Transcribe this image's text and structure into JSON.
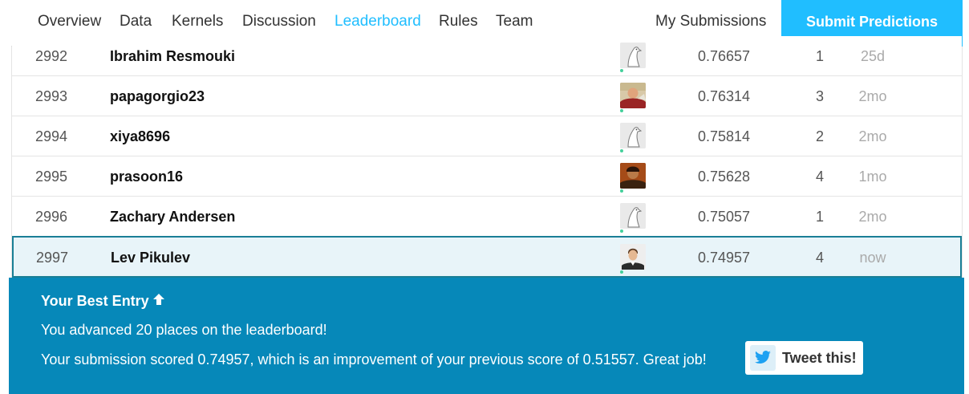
{
  "nav": {
    "tabs": [
      {
        "label": "Overview"
      },
      {
        "label": "Data"
      },
      {
        "label": "Kernels"
      },
      {
        "label": "Discussion"
      },
      {
        "label": "Leaderboard"
      },
      {
        "label": "Rules"
      },
      {
        "label": "Team"
      }
    ],
    "active_tab": "Leaderboard",
    "my_submissions_label": "My Submissions",
    "submit_label": "Submit Predictions"
  },
  "leaderboard": {
    "rows": [
      {
        "rank": "2992",
        "name": "Ibrahim Resmouki",
        "avatar": "default-goose-avatar",
        "score": "0.76657",
        "entries": "1",
        "last": "25d"
      },
      {
        "rank": "2993",
        "name": "papagorgio23",
        "avatar": "user-photo-avatar",
        "score": "0.76314",
        "entries": "3",
        "last": "2mo"
      },
      {
        "rank": "2994",
        "name": "xiya8696",
        "avatar": "default-goose-avatar",
        "score": "0.75814",
        "entries": "2",
        "last": "2mo"
      },
      {
        "rank": "2995",
        "name": "prasoon16",
        "avatar": "user-photo-avatar",
        "score": "0.75628",
        "entries": "4",
        "last": "1mo"
      },
      {
        "rank": "2996",
        "name": "Zachary Andersen",
        "avatar": "default-goose-avatar",
        "score": "0.75057",
        "entries": "1",
        "last": "2mo"
      },
      {
        "rank": "2997",
        "name": "Lev Pikulev",
        "avatar": "user-photo-avatar",
        "score": "0.74957",
        "entries": "4",
        "last": "now"
      }
    ]
  },
  "banner": {
    "title": "Your Best Entry",
    "title_icon": "arrow-up-icon",
    "line1": "You advanced 20 places on the leaderboard!",
    "line2": "Your submission scored 0.74957, which is an improvement of your previous score of 0.51557. Great job!",
    "tweet_label": "Tweet this!",
    "tweet_icon": "twitter-bird-icon"
  },
  "colors": {
    "accent": "#20beff",
    "banner": "#0688b9",
    "current_row_bg": "#e8f4f9",
    "current_row_border": "#1a7f96",
    "online_dot": "#44d09b"
  }
}
